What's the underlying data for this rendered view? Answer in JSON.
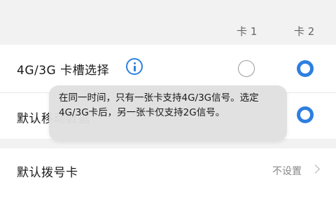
{
  "column_headers": {
    "card1": "卡 1",
    "card2": "卡 2"
  },
  "rows": {
    "slot_select": {
      "label": "4G/3G 卡槽选择",
      "card1_selected": false,
      "card2_selected": true
    },
    "default_data": {
      "label": "默认移动数据",
      "card2_selected": true
    },
    "default_dial": {
      "label": "默认拨号卡",
      "value": "不设置"
    }
  },
  "tooltip": {
    "text": "在同一时间，只有一张卡支持4G/3G信号。选定4G/3G卡后，另一张卡仅支持2G信号。"
  },
  "colors": {
    "accent": "#2d7fe0",
    "background": "#f2f2f2",
    "card": "#ffffff"
  },
  "icons": {
    "info": "info-icon",
    "chevron": "chevron-right-icon"
  }
}
